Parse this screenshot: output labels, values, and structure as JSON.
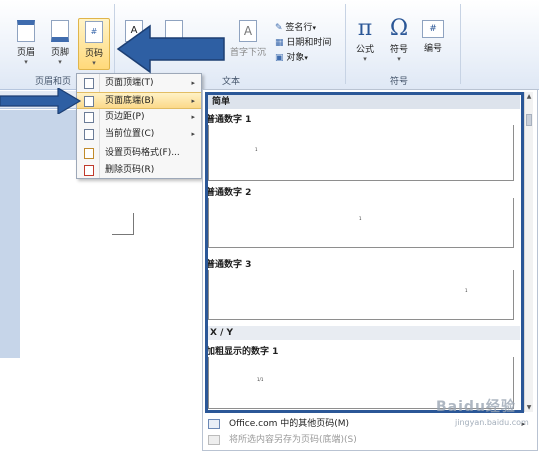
{
  "ribbon": {
    "buttons": {
      "header": "页眉",
      "footer": "页脚",
      "page_number": "页码",
      "quick_parts": "首字下沉",
      "signature_line": "签名行",
      "date_time": "日期和时间",
      "object": "对象",
      "equation": "公式",
      "symbol": "符号",
      "numbering": "编号"
    },
    "glyphs": {
      "equation": "π",
      "symbol": "Ω",
      "numbering": "#"
    },
    "groups": {
      "header_footer": "页眉和页",
      "text": "文本",
      "symbols": "符号"
    }
  },
  "menu": {
    "items": [
      {
        "label": "页面顶端(T)",
        "submenu": true
      },
      {
        "label": "页面底端(B)",
        "submenu": true
      },
      {
        "label": "页边距(P)",
        "submenu": true
      },
      {
        "label": "当前位置(C)",
        "submenu": true
      },
      {
        "label": "设置页码格式(F)...",
        "submenu": false
      },
      {
        "label": "删除页码(R)",
        "submenu": false
      }
    ],
    "arrow_glyph": "▸"
  },
  "gallery": {
    "header": "简单",
    "items": [
      {
        "title": "普通数字 1",
        "sample": "1"
      },
      {
        "title": "普通数字 2",
        "sample": "1"
      },
      {
        "title": "普通数字 3",
        "sample": "1"
      }
    ],
    "section_xy": "X / Y",
    "bold_item": {
      "title": "加粗显示的数字 1",
      "sample": "1/1"
    },
    "footer": {
      "more_label": "Office.com 中的其他页码(M)",
      "save_label": "将所选内容另存为页码(底端)(S)"
    }
  },
  "watermark": {
    "brand": "Baidu经验",
    "url": "jingyan.baidu.com"
  },
  "colors": {
    "frame": "#2b5797",
    "arrow": "#2e5fa3",
    "highlight": "#ffd97a"
  }
}
